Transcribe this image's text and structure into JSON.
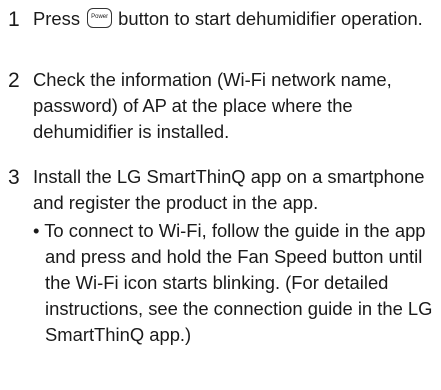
{
  "steps": [
    {
      "number": "1",
      "text_before": "Press",
      "button_label": "Power",
      "text_after": "button to start dehumidifier operation."
    },
    {
      "number": "2",
      "text": "Check the information (Wi-Fi network name, password) of AP at the place where the dehumidifier is installed."
    },
    {
      "number": "3",
      "text": "Install the LG SmartThinQ app on a smartphone and register the product in the app.",
      "sub_bullet": "•",
      "sub_text": "To connect to Wi-Fi, follow the guide in the app and press and hold the Fan Speed button until the Wi-Fi icon starts blinking. (For detailed instructions, see the connection guide in the LG SmartThinQ app.)"
    }
  ]
}
